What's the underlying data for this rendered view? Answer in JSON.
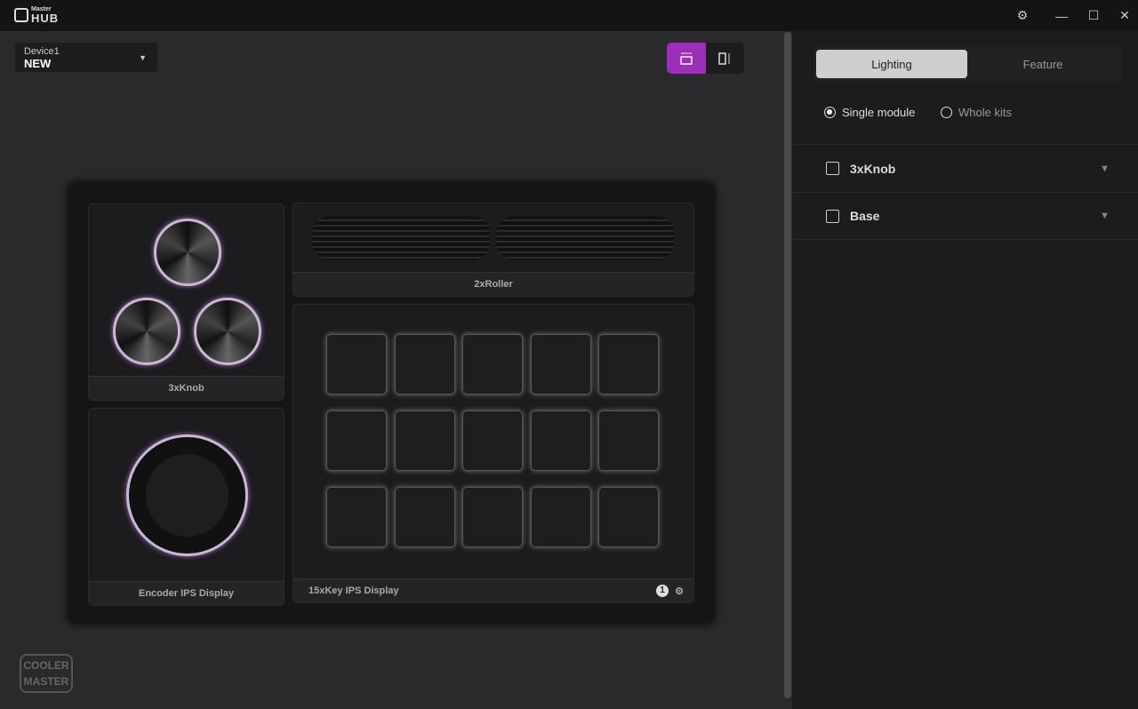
{
  "app": {
    "logo_small": "Master",
    "logo_big": "HUB"
  },
  "window": {
    "settings": "⚙",
    "minimize": "—",
    "maximize": "☐",
    "close": "✕"
  },
  "device": {
    "name": "Device1",
    "profile": "NEW"
  },
  "modules": {
    "knob": "3xKnob",
    "roller": "2xRoller",
    "encoder": "Encoder IPS Display",
    "keys": "15xKey IPS Display",
    "keys_page": "1"
  },
  "panel": {
    "tabs": [
      "Lighting",
      "Feature"
    ],
    "active_tab": "Lighting",
    "radio": [
      "Single module",
      "Whole kits"
    ],
    "selected_radio": "Single module",
    "sections": [
      "3xKnob",
      "Base"
    ]
  },
  "brand": {
    "logo_line1": "COOLER",
    "logo_line2": "MASTER"
  },
  "colors": {
    "accent": "#9b2fb5"
  }
}
